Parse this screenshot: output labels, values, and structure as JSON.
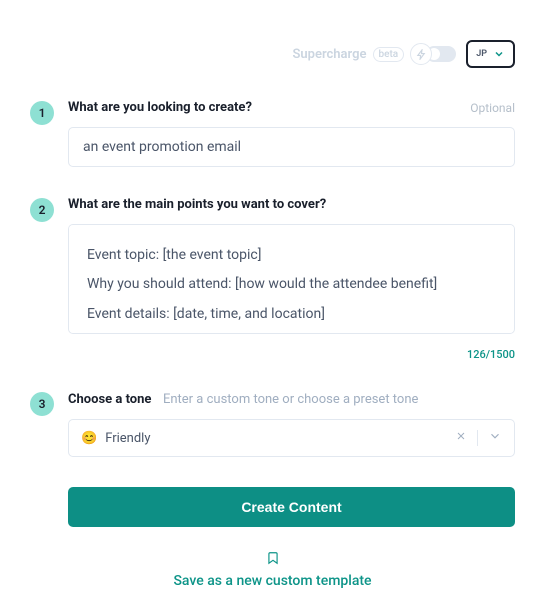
{
  "topbar": {
    "supercharge": {
      "label": "Supercharge",
      "badge": "beta"
    },
    "user": {
      "initials": "JP"
    }
  },
  "form": {
    "step1": {
      "num": "1",
      "label": "What are you looking to create?",
      "optional": "Optional",
      "value": "an event promotion email"
    },
    "step2": {
      "num": "2",
      "label": "What are the main points you want to cover?",
      "value": "Event topic: [the event topic]\nWhy you should attend: [how would the attendee benefit]\nEvent details: [date, time, and location]",
      "counter": "126/1500"
    },
    "step3": {
      "num": "3",
      "label": "Choose a tone",
      "hint": "Enter a custom tone or choose a preset tone",
      "selected": {
        "emoji": "😊",
        "label": "Friendly"
      }
    }
  },
  "actions": {
    "create": "Create Content",
    "save_template": "Save as a new custom template"
  }
}
